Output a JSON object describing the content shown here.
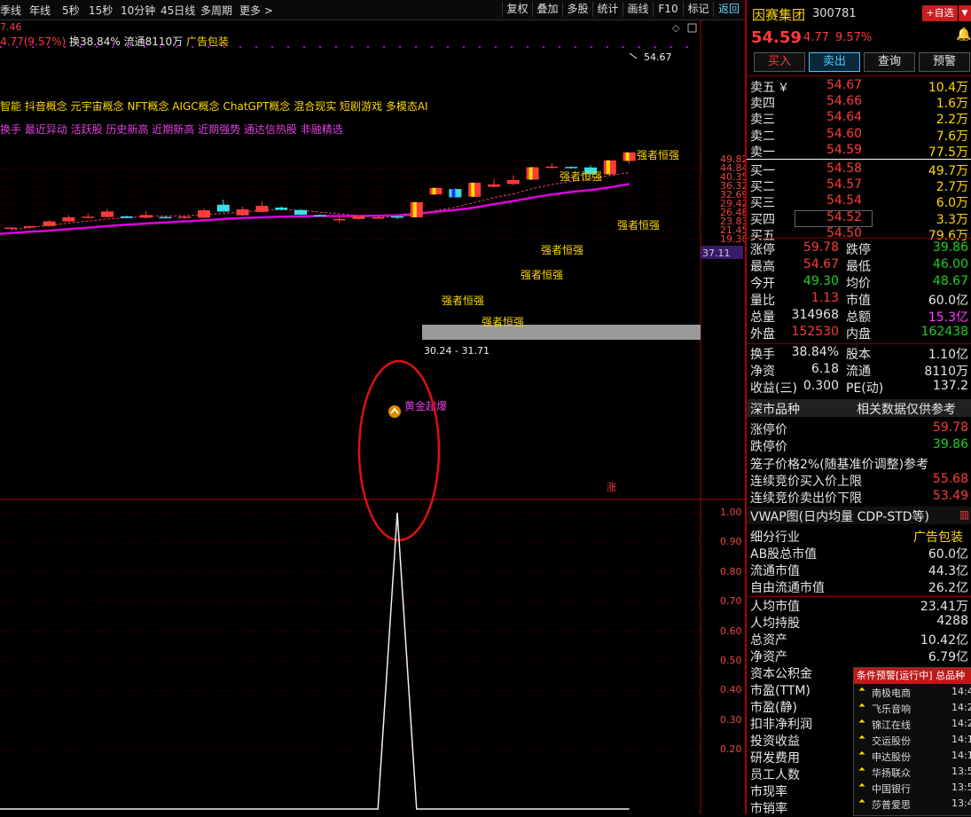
{
  "toolbar": {
    "periods": [
      "季线",
      "年线",
      "5秒",
      "15秒",
      "10分钟",
      "45日线",
      "多周期",
      "更多 >"
    ],
    "buttons": [
      "复权",
      "叠加",
      "多股",
      "统计",
      "画线",
      "F10",
      "标记",
      "返回"
    ]
  },
  "info": {
    "partial_price": "7.46",
    "change": "4.77(9.57%)",
    "turnover": "换38.84%",
    "float": "流通8110万",
    "ad": "广告包装"
  },
  "concepts": "智能 抖音概念 元宇宙概念 NFT概念 AIGC概念 ChatGPT概念 混合现实 短剧游戏 多模态AI",
  "tags": "换手 最近异动 活跃股 历史新高 近期新高 近期强势 通达信热股 非融精选",
  "chart_data": [
    {
      "type": "candlestick",
      "y_ticks": [
        "49.82",
        "44.84",
        "40.35",
        "36.32",
        "32.69",
        "29.42",
        "26.48",
        "23.83",
        "21.45",
        "19.30"
      ],
      "price_marker": "37.11",
      "high_label": "54.67",
      "range_label": "30.24 - 31.71",
      "annotations": [
        "强者恒强",
        "强者恒强",
        "强者恒强",
        "强者恒强",
        "强者恒强",
        "强者恒强",
        "强者恒强",
        "黄金起爆"
      ],
      "zhang_marker": "涨",
      "candles": [
        {
          "o": 22.0,
          "c": 22.2,
          "h": 22.3,
          "l": 21.9
        },
        {
          "o": 22.2,
          "c": 22.6,
          "h": 22.7,
          "l": 22.0
        },
        {
          "o": 22.6,
          "c": 23.9,
          "h": 24.3,
          "l": 22.5
        },
        {
          "o": 23.9,
          "c": 25.1,
          "h": 25.8,
          "l": 23.8
        },
        {
          "o": 25.0,
          "c": 25.3,
          "h": 26.2,
          "l": 24.9
        },
        {
          "o": 25.2,
          "c": 26.9,
          "h": 27.8,
          "l": 25.1
        },
        {
          "o": 25.4,
          "c": 24.9,
          "h": 25.6,
          "l": 24.8
        },
        {
          "o": 25.0,
          "c": 25.8,
          "h": 27.0,
          "l": 24.8
        },
        {
          "o": 25.2,
          "c": 24.9,
          "h": 25.4,
          "l": 24.7
        },
        {
          "o": 24.9,
          "c": 25.3,
          "h": 25.4,
          "l": 24.7
        },
        {
          "o": 25.0,
          "c": 27.3,
          "h": 27.8,
          "l": 24.9
        },
        {
          "o": 29.2,
          "c": 26.9,
          "h": 31.0,
          "l": 26.8
        },
        {
          "o": 25.7,
          "c": 27.6,
          "h": 28.5,
          "l": 25.5
        },
        {
          "o": 26.8,
          "c": 28.8,
          "h": 30.5,
          "l": 26.6
        },
        {
          "o": 28.2,
          "c": 27.5,
          "h": 28.6,
          "l": 27.3
        },
        {
          "o": 27.4,
          "c": 25.9,
          "h": 27.7,
          "l": 25.8
        },
        {
          "o": 25.8,
          "c": 25.6,
          "h": 26.0,
          "l": 25.5
        },
        {
          "o": 24.5,
          "c": 24.6,
          "h": 25.2,
          "l": 23.6
        },
        {
          "o": 24.6,
          "c": 25.4,
          "h": 25.5,
          "l": 24.4
        },
        {
          "o": 25.1,
          "c": 25.1,
          "h": 25.4,
          "l": 24.9
        },
        {
          "o": 25.4,
          "c": 25.1,
          "h": 25.6,
          "l": 24.6
        },
        {
          "o": 25.1,
          "c": 30.1,
          "h": 30.2,
          "l": 25.0
        },
        {
          "o": 33.0,
          "c": 35.7,
          "h": 35.8,
          "l": 33.0
        },
        {
          "o": 35.2,
          "c": 31.9,
          "h": 35.5,
          "l": 31.8
        },
        {
          "o": 32.1,
          "c": 38.0,
          "h": 38.0,
          "l": 32.0
        },
        {
          "o": 36.2,
          "c": 37.2,
          "h": 39.6,
          "l": 35.9
        },
        {
          "o": 37.4,
          "c": 39.2,
          "h": 41.5,
          "l": 36.8
        },
        {
          "o": 39.4,
          "c": 45.7,
          "h": 46.0,
          "l": 39.3
        },
        {
          "o": 45.4,
          "c": 46.1,
          "h": 47.8,
          "l": 44.9
        },
        {
          "o": 45.9,
          "c": 45.4,
          "h": 46.2,
          "l": 45.0
        },
        {
          "o": 45.6,
          "c": 42.1,
          "h": 46.8,
          "l": 41.9
        },
        {
          "o": 42.0,
          "c": 49.6,
          "h": 49.6,
          "l": 41.5
        },
        {
          "o": 49.3,
          "c": 54.6,
          "h": 54.7,
          "l": 47.5
        }
      ],
      "ma_magenta": [
        20.8,
        21.1,
        21.4,
        21.8,
        22.2,
        22.6,
        23.0,
        23.3,
        23.6,
        23.9,
        24.2,
        24.6,
        24.9,
        25.1,
        25.3,
        25.4,
        25.5,
        25.5,
        25.5,
        25.6,
        25.7,
        26.2,
        26.8,
        27.4,
        28.2,
        29.4,
        30.5,
        31.8,
        33.0,
        34.0,
        34.8,
        35.9,
        37.4
      ],
      "ma_dashed": [
        21.6,
        22.2,
        22.8,
        23.4,
        24.0,
        24.6,
        25.0,
        25.4,
        25.5,
        25.6,
        25.9,
        26.3,
        26.8,
        27.3,
        27.5,
        27.3,
        26.7,
        26.2,
        25.6,
        25.3,
        25.2,
        25.9,
        27.2,
        28.3,
        30.0,
        31.8,
        33.2,
        35.4,
        37.2,
        38.6,
        39.8,
        41.4,
        42.9
      ]
    },
    {
      "type": "line",
      "y_ticks": [
        "1.00",
        "0.90",
        "0.80",
        "0.70",
        "0.60",
        "0.50",
        "0.40",
        "0.30",
        "0.20"
      ],
      "values": [
        0,
        0,
        0,
        0,
        0,
        0,
        0,
        0,
        0,
        0,
        0,
        0,
        0,
        0,
        0,
        0,
        0,
        0,
        0,
        0,
        1,
        0,
        0,
        0,
        0,
        0,
        0,
        0,
        0,
        0,
        0,
        0,
        0
      ]
    }
  ],
  "stock": {
    "name": "因赛集团",
    "code": "300781",
    "add_btn": "+自选",
    "price": "54.59",
    "change": "4.77",
    "pct": "9.57%",
    "buy_btn": "买入",
    "sell_btn": "卖出",
    "query_btn": "查询",
    "warn_btn": "预警"
  },
  "orderbook": [
    {
      "label": "卖五",
      "price": "54.67",
      "vol": "10.4万"
    },
    {
      "label": "卖四",
      "price": "54.66",
      "vol": "1.6万"
    },
    {
      "label": "卖三",
      "price": "54.64",
      "vol": "2.2万"
    },
    {
      "label": "卖二",
      "price": "54.60",
      "vol": "7.6万"
    },
    {
      "label": "卖一",
      "price": "54.59",
      "vol": "77.5万"
    },
    {
      "label": "买一",
      "price": "54.58",
      "vol": "49.7万"
    },
    {
      "label": "买二",
      "price": "54.57",
      "vol": "2.7万"
    },
    {
      "label": "买三",
      "price": "54.54",
      "vol": "6.0万"
    },
    {
      "label": "买四",
      "price": "54.52",
      "vol": "3.3万"
    },
    {
      "label": "买五",
      "price": "54.50",
      "vol": "79.6万"
    }
  ],
  "yen_sign": "￥",
  "stats": [
    {
      "l1": "涨停",
      "v1": "59.78",
      "c1": "red",
      "l2": "跌停",
      "v2": "39.86",
      "c2": "green"
    },
    {
      "l1": "最高",
      "v1": "54.67",
      "c1": "red",
      "l2": "最低",
      "v2": "46.00",
      "c2": "green"
    },
    {
      "l1": "今开",
      "v1": "49.30",
      "c1": "green",
      "l2": "均价",
      "v2": "48.67",
      "c2": "green"
    },
    {
      "l1": "量比",
      "v1": "1.13",
      "c1": "red",
      "l2": "市值",
      "v2": "60.0亿",
      "c2": "wht"
    },
    {
      "l1": "总量",
      "v1": "314968",
      "c1": "wht",
      "l2": "总额",
      "v2": "15.3亿",
      "c2": "mag"
    },
    {
      "l1": "外盘",
      "v1": "152530",
      "c1": "red",
      "l2": "内盘",
      "v2": "162438",
      "c2": "green"
    }
  ],
  "stats2": [
    {
      "l1": "换手",
      "v1": "38.84%",
      "l2": "股本",
      "v2": "1.10亿"
    },
    {
      "l1": "净资",
      "v1": "6.18",
      "l2": "流通",
      "v2": "8110万"
    },
    {
      "l1": "收益(三)",
      "v1": "0.300",
      "l2": "PE(动)",
      "v2": "137.2"
    }
  ],
  "exchange": {
    "label": "深市品种",
    "note": "相关数据仅供参考"
  },
  "limit": [
    {
      "l": "涨停价",
      "v": "59.78",
      "c": "red"
    },
    {
      "l": "跌停价",
      "v": "39.86",
      "c": "green"
    }
  ],
  "cage": "笼子价格2%(随基准价调整)参考",
  "auction": [
    {
      "l": "连续竞价买入价上限",
      "v": "55.68",
      "c": "red"
    },
    {
      "l": "连续竞价卖出价下限",
      "v": "53.49",
      "c": "red"
    }
  ],
  "vwap": "VWAP图(日内均量 CDP-STD等)",
  "industry": {
    "label": "细分行业",
    "value": "广告包装"
  },
  "fundamentals": [
    {
      "l": "AB股总市值",
      "v": "60.0亿"
    },
    {
      "l": "流通市值",
      "v": "44.3亿"
    },
    {
      "l": "自由流通市值",
      "v": "26.2亿"
    },
    {
      "l": "人均市值",
      "v": "23.41万"
    },
    {
      "l": "人均持股",
      "v": "4288"
    },
    {
      "l": "总资产",
      "v": "10.42亿"
    },
    {
      "l": "净资产",
      "v": "6.79亿"
    },
    {
      "l": "资本公积金",
      "v": ""
    },
    {
      "l": "市盈(TTM)",
      "v": ""
    },
    {
      "l": "市盈(静)",
      "v": ""
    },
    {
      "l": "扣非净利润",
      "v": ""
    },
    {
      "l": "投资收益",
      "v": ""
    },
    {
      "l": "研发费用",
      "v": ""
    },
    {
      "l": "员工人数",
      "v": ""
    },
    {
      "l": "市现率",
      "v": ""
    },
    {
      "l": "市销率",
      "v": ""
    }
  ],
  "alert": {
    "title": "条件预警[运行中] 总品种",
    "items": [
      {
        "name": "南极电商",
        "time": "14:4"
      },
      {
        "name": "飞乐音响",
        "time": "14:2"
      },
      {
        "name": "锦江在线",
        "time": "14:2"
      },
      {
        "name": "交运股份",
        "time": "14:1"
      },
      {
        "name": "申达股份",
        "time": "14:1"
      },
      {
        "name": "华扬联众",
        "time": "13:5"
      },
      {
        "name": "中国银行",
        "time": "13:5"
      },
      {
        "name": "莎普爱思",
        "time": "13:4"
      }
    ]
  }
}
